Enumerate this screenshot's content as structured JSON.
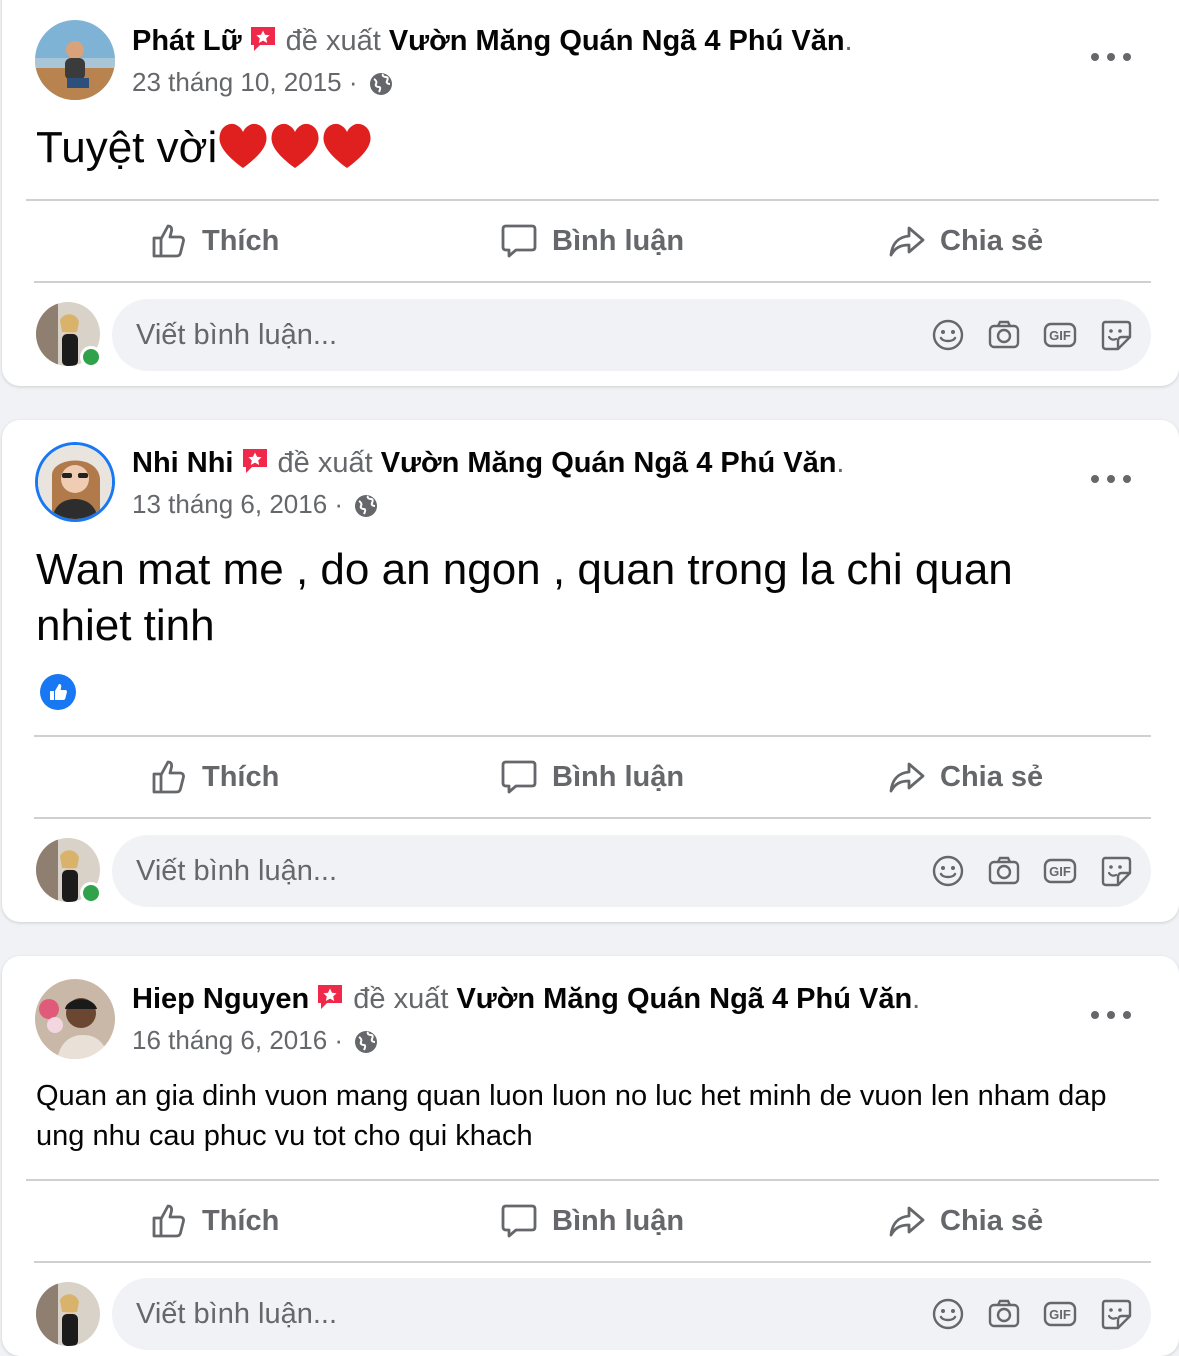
{
  "colors": {
    "page_bg": "#f0f2f5",
    "card_bg": "#ffffff",
    "secondary_text": "#65676b",
    "accent_blue": "#1877f2",
    "badge_red": "#f02849",
    "online_green": "#31a24c"
  },
  "posts": [
    {
      "author": "Phát Lữ",
      "recommends": "đề xuất",
      "place": "Vườn Măng Quán Ngã 4 Phú Văn",
      "period": ".",
      "date": "23 tháng 10, 2015",
      "separator": "·",
      "audience_icon": "globe-icon",
      "text": "Tuyệt vời",
      "emoji": [
        "red-heart",
        "red-heart",
        "red-heart"
      ],
      "reactions": []
    },
    {
      "author": "Nhi Nhi",
      "recommends": "đề xuất",
      "place": "Vườn Măng Quán Ngã 4 Phú Văn",
      "period": ".",
      "date": "13 tháng 6, 2016",
      "separator": "·",
      "audience_icon": "globe-icon",
      "text": "Wan mat me , do an ngon , quan trong la chi quan nhiet tinh",
      "emoji": [],
      "reactions": [
        "like"
      ]
    },
    {
      "author": "Hiep Nguyen",
      "recommends": "đề xuất",
      "place": "Vườn Măng Quán Ngã 4 Phú Văn",
      "period": ".",
      "date": "16 tháng 6, 2016",
      "separator": "·",
      "audience_icon": "globe-icon",
      "text": "Quan an gia dinh vuon mang quan luon luon no luc het minh de vuon len nham dap ung nhu cau phuc vu tot cho qui khach",
      "emoji": [],
      "reactions": []
    }
  ],
  "actions": {
    "like": "Thích",
    "comment": "Bình luận",
    "share": "Chia sẻ"
  },
  "comment_box": {
    "placeholder": "Viết bình luận...",
    "tools": [
      "emoji-icon",
      "camera-icon",
      "gif-icon",
      "sticker-icon"
    ]
  }
}
